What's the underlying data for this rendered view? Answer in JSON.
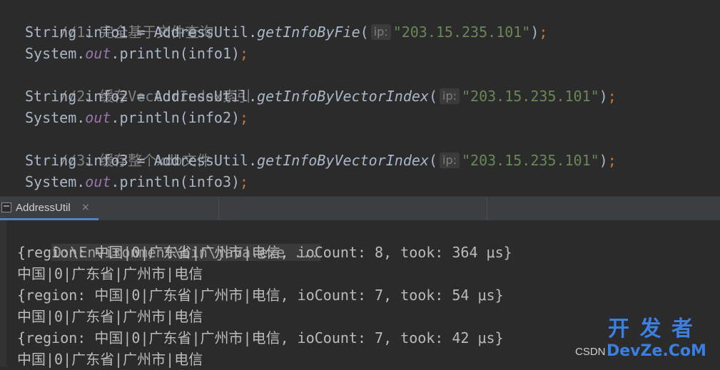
{
  "code_lines": [
    {
      "comment": "//1、完全基于文件查询"
    },
    {
      "type": "String",
      "var": "info1",
      "eq": " = ",
      "cls": "AddressUtil",
      "dot": ".",
      "method": "getInfoByFie",
      "open": "(",
      "hint": "ip:",
      "arg": "\"203.15.235.101\"",
      "close": ")",
      "semi": ";"
    },
    {
      "obj": "System",
      "dot": ".",
      "field": "out",
      "call": ".println(info1)",
      "semi": ";"
    },
    {
      "comment": "//2、缓存VectorIndex索引"
    },
    {
      "type": "String",
      "var": "info2",
      "eq": " = ",
      "cls": "AddressUtil",
      "dot": ".",
      "method": "getInfoByVectorIndex",
      "open": "(",
      "hint": "ip:",
      "arg": "\"203.15.235.101\"",
      "close": ")",
      "semi": ";"
    },
    {
      "obj": "System",
      "dot": ".",
      "field": "out",
      "call": ".println(info2)",
      "semi": ";"
    },
    {
      "comment": "//3、缓存整个xdb文件"
    },
    {
      "type": "String",
      "var": "info3",
      "eq": " = ",
      "cls": "AddressUtil",
      "dot": ".",
      "method": "getInfoByVectorIndex",
      "open": "(",
      "hint": "ip:",
      "arg": "\"203.15.235.101\"",
      "close": ")",
      "semi": ";"
    },
    {
      "obj": "System",
      "dot": ".",
      "field": "out",
      "call": ".println(info3)",
      "semi": ";"
    }
  ],
  "run_tab": {
    "label": "AddressUtil",
    "close": "×"
  },
  "console": {
    "command": "D:\\Environment\\bin\\java.exe ...",
    "lines": [
      "{region: 中国|0|广东省|广州市|电信, ioCount: 8, took: 364 μs}",
      "中国|0|广东省|广州市|电信",
      "{region: 中国|0|广东省|广州市|电信, ioCount: 7, took: 54 μs}",
      "中国|0|广东省|广州市|电信",
      "{region: 中国|0|广东省|广州市|电信, ioCount: 7, took: 42 μs}",
      "中国|0|广东省|广州市|电信"
    ]
  },
  "watermark": {
    "main": "开 发 者",
    "sub": "DevZe.CoM",
    "csdn": "CSDN"
  },
  "colors": {
    "background": "#2b2b2b",
    "comment": "#808080",
    "string": "#6a8759",
    "keyword_semicolon": "#cc7832",
    "static_field": "#9876aa",
    "tab_underline": "#4a88c7",
    "watermark": "#3b7fe0"
  }
}
